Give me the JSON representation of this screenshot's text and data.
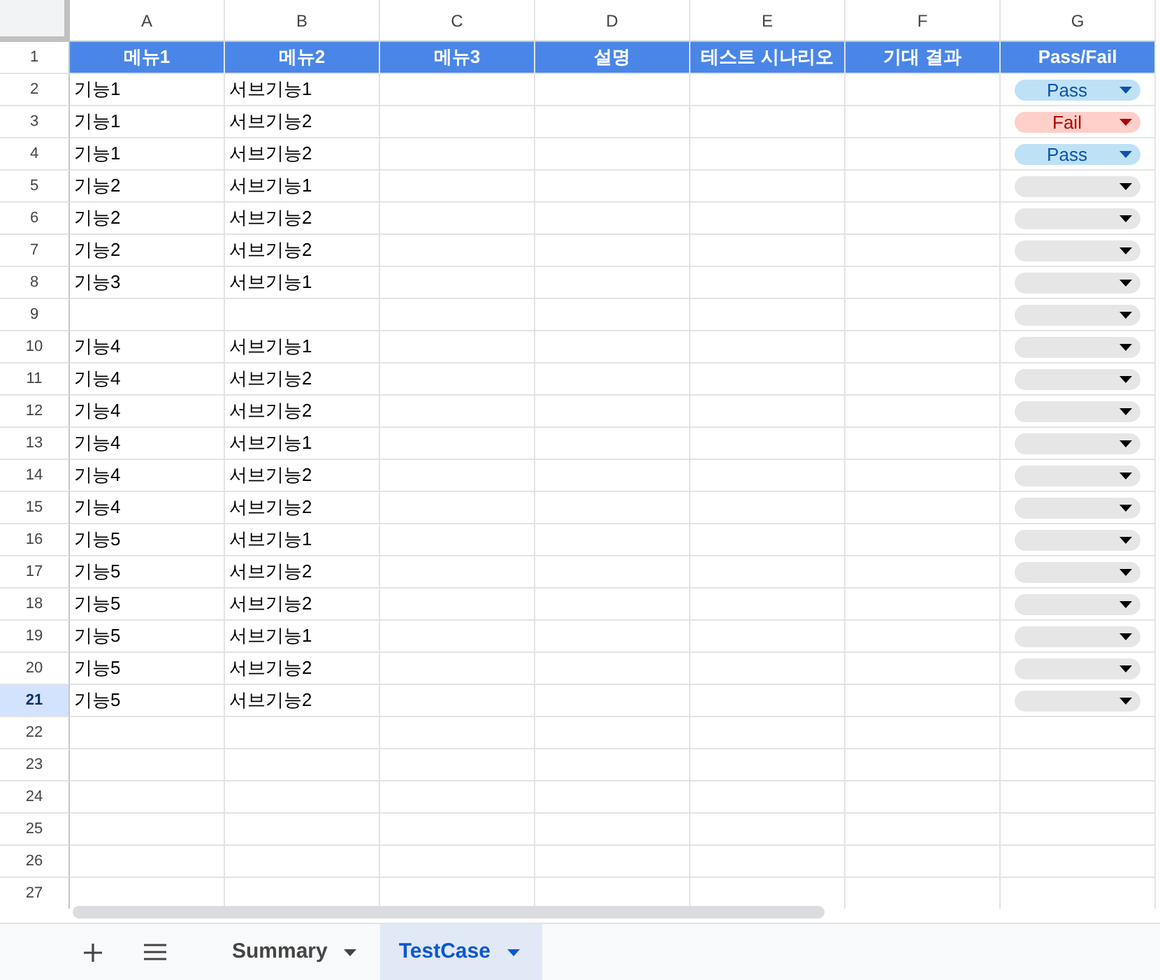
{
  "columns": [
    "A",
    "B",
    "C",
    "D",
    "E",
    "F",
    "G"
  ],
  "header_row": {
    "number": "1",
    "selected": false,
    "cells": [
      "메뉴1",
      "메뉴2",
      "메뉴3",
      "설명",
      "테스트 시나리오",
      "기대 결과",
      "Pass/Fail"
    ]
  },
  "rows": [
    {
      "number": "2",
      "selected": false,
      "cells": [
        "기능1",
        "서브기능1"
      ],
      "status": {
        "kind": "pass",
        "label": "Pass"
      }
    },
    {
      "number": "3",
      "selected": false,
      "cells": [
        "기능1",
        "서브기능2"
      ],
      "status": {
        "kind": "fail",
        "label": "Fail"
      }
    },
    {
      "number": "4",
      "selected": false,
      "cells": [
        "기능1",
        "서브기능2"
      ],
      "status": {
        "kind": "pass",
        "label": "Pass"
      }
    },
    {
      "number": "5",
      "selected": false,
      "cells": [
        "기능2",
        "서브기능1"
      ],
      "status": {
        "kind": "blank"
      }
    },
    {
      "number": "6",
      "selected": false,
      "cells": [
        "기능2",
        "서브기능2"
      ],
      "status": {
        "kind": "blank"
      }
    },
    {
      "number": "7",
      "selected": false,
      "cells": [
        "기능2",
        "서브기능2"
      ],
      "status": {
        "kind": "blank"
      }
    },
    {
      "number": "8",
      "selected": false,
      "cells": [
        "기능3",
        "서브기능1"
      ],
      "status": {
        "kind": "blank"
      }
    },
    {
      "number": "9",
      "selected": false,
      "cells": [],
      "status": {
        "kind": "blank"
      }
    },
    {
      "number": "10",
      "selected": false,
      "cells": [
        "기능4",
        "서브기능1"
      ],
      "status": {
        "kind": "blank"
      }
    },
    {
      "number": "11",
      "selected": false,
      "cells": [
        "기능4",
        "서브기능2"
      ],
      "status": {
        "kind": "blank"
      }
    },
    {
      "number": "12",
      "selected": false,
      "cells": [
        "기능4",
        "서브기능2"
      ],
      "status": {
        "kind": "blank"
      }
    },
    {
      "number": "13",
      "selected": false,
      "cells": [
        "기능4",
        "서브기능1"
      ],
      "status": {
        "kind": "blank"
      }
    },
    {
      "number": "14",
      "selected": false,
      "cells": [
        "기능4",
        "서브기능2"
      ],
      "status": {
        "kind": "blank"
      }
    },
    {
      "number": "15",
      "selected": false,
      "cells": [
        "기능4",
        "서브기능2"
      ],
      "status": {
        "kind": "blank"
      }
    },
    {
      "number": "16",
      "selected": false,
      "cells": [
        "기능5",
        "서브기능1"
      ],
      "status": {
        "kind": "blank"
      }
    },
    {
      "number": "17",
      "selected": false,
      "cells": [
        "기능5",
        "서브기능2"
      ],
      "status": {
        "kind": "blank"
      }
    },
    {
      "number": "18",
      "selected": false,
      "cells": [
        "기능5",
        "서브기능2"
      ],
      "status": {
        "kind": "blank"
      }
    },
    {
      "number": "19",
      "selected": false,
      "cells": [
        "기능5",
        "서브기능1"
      ],
      "status": {
        "kind": "blank"
      }
    },
    {
      "number": "20",
      "selected": false,
      "cells": [
        "기능5",
        "서브기능2"
      ],
      "status": {
        "kind": "blank"
      }
    },
    {
      "number": "21",
      "selected": true,
      "cells": [
        "기능5",
        "서브기능2"
      ],
      "status": {
        "kind": "blank"
      }
    },
    {
      "number": "22",
      "selected": false,
      "cells": []
    },
    {
      "number": "23",
      "selected": false,
      "cells": []
    },
    {
      "number": "24",
      "selected": false,
      "cells": []
    },
    {
      "number": "25",
      "selected": false,
      "cells": []
    },
    {
      "number": "26",
      "selected": false,
      "cells": []
    },
    {
      "number": "27",
      "selected": false,
      "cells": []
    }
  ],
  "sheet_tabs": [
    {
      "label": "Summary",
      "selected": false
    },
    {
      "label": "TestCase",
      "selected": true
    }
  ]
}
